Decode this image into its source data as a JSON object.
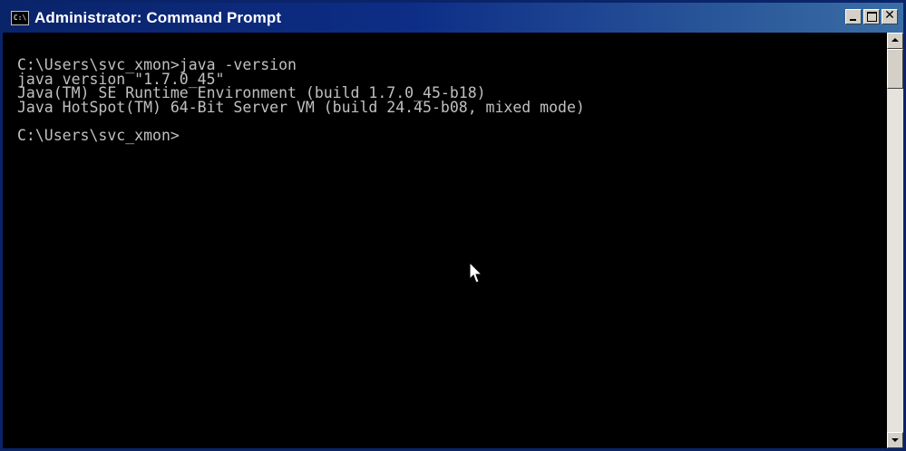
{
  "window": {
    "title": "Administrator: Command Prompt",
    "icon_label": "C:\\",
    "buttons": {
      "minimize": "minimize-icon",
      "maximize": "maximize-icon",
      "close": "close-icon",
      "close_glyph": "✕"
    }
  },
  "console": {
    "lines": [
      "C:\\Users\\svc_xmon>java -version",
      "java version \"1.7.0_45\"",
      "Java(TM) SE Runtime Environment (build 1.7.0_45-b18)",
      "Java HotSpot(TM) 64-Bit Server VM (build 24.45-b08, mixed mode)",
      "",
      "C:\\Users\\svc_xmon>"
    ],
    "background": "#000000",
    "foreground": "#c0c0c0"
  },
  "scrollbar": {
    "up_icon": "scroll-up-arrow-icon",
    "down_icon": "scroll-down-arrow-icon"
  },
  "cursor": {
    "icon": "mouse-pointer-icon"
  }
}
